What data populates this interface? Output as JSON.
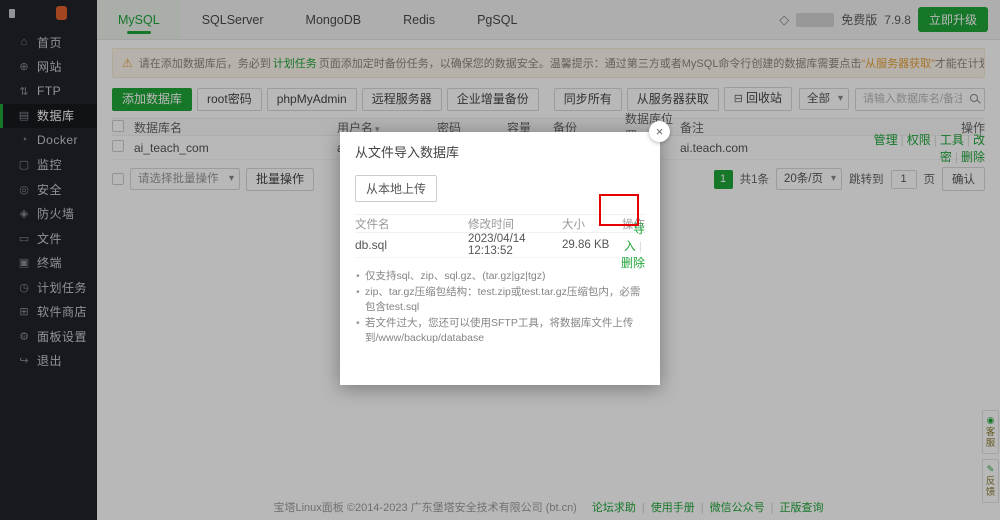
{
  "colors": {
    "accent_green": "#20a53a",
    "annotation_red": "#e60000",
    "warning_orange": "#e6a23c",
    "notification_orange": "#e0622b",
    "sidebar_bg": "#20232a"
  },
  "sidebar": {
    "items": [
      {
        "icon": "⌂",
        "label": "首页",
        "active": false
      },
      {
        "icon": "⊕",
        "label": "网站",
        "active": false
      },
      {
        "icon": "⇅",
        "label": "FTP",
        "active": false
      },
      {
        "icon": "▤",
        "label": "数据库",
        "active": true
      },
      {
        "icon": "◔",
        "label": "Docker",
        "active": false
      },
      {
        "icon": "▢",
        "label": "监控",
        "active": false
      },
      {
        "icon": "◎",
        "label": "安全",
        "active": false
      },
      {
        "icon": "◈",
        "label": "防火墙",
        "active": false
      },
      {
        "icon": "▭",
        "label": "文件",
        "active": false
      },
      {
        "icon": "▣",
        "label": "终端",
        "active": false
      },
      {
        "icon": "◷",
        "label": "计划任务",
        "active": false
      },
      {
        "icon": "⊞",
        "label": "软件商店",
        "active": false
      },
      {
        "icon": "⚙",
        "label": "面板设置",
        "active": false
      },
      {
        "icon": "↪",
        "label": "退出",
        "active": false
      }
    ]
  },
  "tabs": {
    "items": [
      "MySQL",
      "SQLServer",
      "MongoDB",
      "Redis",
      "PgSQL"
    ],
    "active": "MySQL"
  },
  "topbar": {
    "diamond_icon": "◇",
    "version_label": "免费版",
    "version": "7.9.8",
    "upgrade_label": "立即升级"
  },
  "notice": {
    "warn_icon": "⚠",
    "pre": "请在添加数据库后，务必到",
    "link": "计划任务",
    "mid": "页面添加定时备份任务，以确保您的数据安全。温馨提示：通过第三方或者MySQL命令行创建的数据库需要点击",
    "highlight": "“从服务器获取”",
    "post": "才能在计划任务中备份"
  },
  "toolbar": {
    "buttons": [
      "添加数据库",
      "root密码",
      "phpMyAdmin",
      "远程服务器",
      "企业增量备份",
      "同步所有",
      "从服务器获取",
      "回收站"
    ],
    "recycle_icon": "⊟",
    "filter_value": "全部",
    "search_placeholder": "请输入数据库名/备注"
  },
  "table": {
    "headers": [
      "数据库名",
      "用户名",
      "密码",
      "容量",
      "备份",
      "数据库位置",
      "备注",
      "操作"
    ],
    "sort_icon": "▾",
    "row": {
      "name": "ai_teach_com",
      "user": "ai_teach_com",
      "note": "ai.teach.com"
    },
    "row_actions": [
      "管理",
      "权限",
      "工具",
      "改密",
      "删除"
    ]
  },
  "batch": {
    "select_placeholder": "请选择批量操作",
    "button_label": "批量操作"
  },
  "pagination": {
    "page": "1",
    "total": "共1条",
    "per_page": "20条/页",
    "jump_label": "跳转到",
    "jump_value": "1",
    "page_word": "页",
    "confirm_label": "确认"
  },
  "modal": {
    "title": "从文件导入数据库",
    "close_icon": "×",
    "upload_button": "从本地上传",
    "headers": [
      "文件名",
      "修改时间",
      "大小",
      "操作"
    ],
    "file": {
      "name": "db.sql",
      "modified": "2023/04/14 12:13:52",
      "size": "29.86 KB"
    },
    "actions": [
      "导入",
      "删除"
    ],
    "notes": [
      "仅支持sql、zip、sql.gz、(tar.gz|gz|tgz)",
      "zip、tar.gz压缩包结构：test.zip或test.tar.gz压缩包内，必需包含test.sql",
      "若文件过大，您还可以使用SFTP工具，将数据库文件上传到/www/backup/database"
    ]
  },
  "footer": {
    "copyright": "宝塔Linux面板 ©2014-2023 广东堡塔安全技术有限公司 (bt.cn)",
    "links": [
      "论坛求助",
      "使用手册",
      "微信公众号",
      "正版查询"
    ]
  },
  "floating": {
    "items": [
      {
        "icon": "◉",
        "label": "客服"
      },
      {
        "icon": "✎",
        "label": "反馈"
      }
    ]
  }
}
